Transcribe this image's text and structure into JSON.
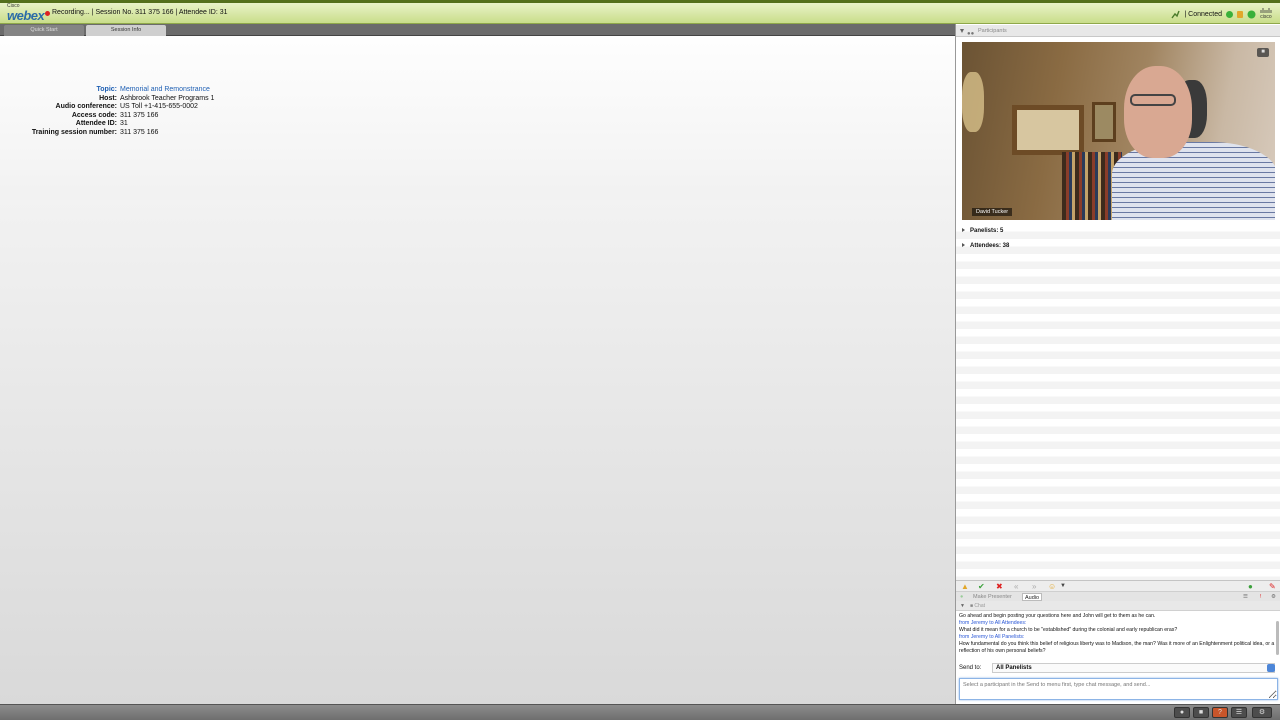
{
  "topbar": {
    "logo_small": "Cisco",
    "logo_main": "webex",
    "session_line": "Recording... | Session No. 311 375 166 | Attendee ID: 31",
    "connection_status": "| Connected",
    "cisco_mini": "cisco"
  },
  "tabs": {
    "quick_start": "Quick Start",
    "session_info": "Session Info"
  },
  "session_info": {
    "topic_label": "Topic:",
    "topic_value": "Memorial and Remonstrance",
    "host_label": "Host:",
    "host_value": "Ashbrook Teacher Programs 1",
    "audio_label": "Audio conference:",
    "audio_value": "US Toll +1-415-655-0002",
    "access_label": "Access code:",
    "access_value": "311 375 166",
    "attendee_label": "Attendee ID:",
    "attendee_value": "31",
    "training_label": "Training session number:",
    "training_value": "311 375 166"
  },
  "participants": {
    "header": "Participants",
    "video_name": "David Tucker",
    "panelists": "Panelists: 5",
    "attendees": "Attendees: 38",
    "make_presenter": "Make Presenter",
    "audio": "Audio"
  },
  "chat": {
    "header": "Chat",
    "lines": [
      {
        "kind": "msg",
        "text": "Go ahead and begin posting your questions here and John will get to them as he can."
      },
      {
        "kind": "from",
        "text": "from Jeremy to All Attendees:"
      },
      {
        "kind": "msg",
        "text": "What did it mean for a church to be \"established\" during the colonial and early republican eras?"
      },
      {
        "kind": "from",
        "text": "from Jeremy to All Panelists:"
      },
      {
        "kind": "msg",
        "text": "How fundamental do you think this belief of religious liberty was to Madison, the man? Was it more of an Enlightenment political idea, or a reflection of his own personal beliefs?"
      }
    ],
    "send_to_label": "Send to:",
    "send_to_value": "All Panelists",
    "input_placeholder": "Select a participant in the Send to menu first, type chat message, and send..."
  }
}
